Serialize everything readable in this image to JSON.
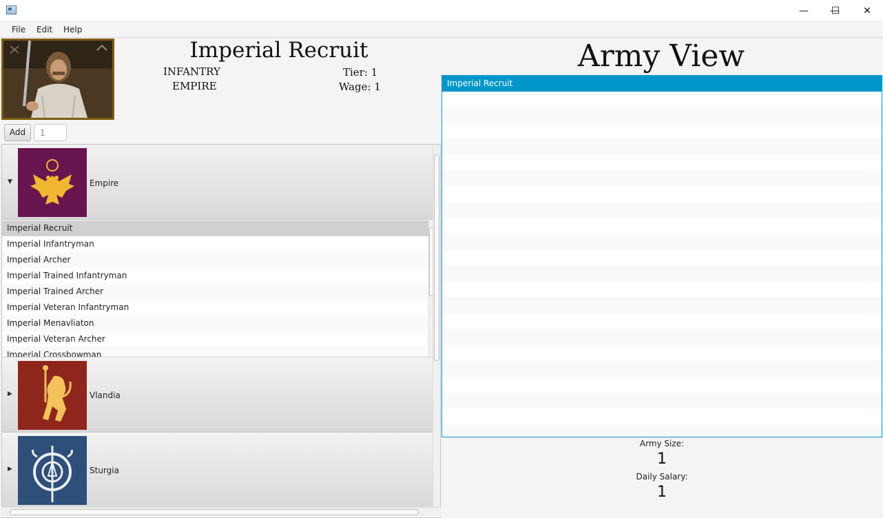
{
  "window": {
    "icons": {
      "app": "app-icon",
      "minimize": "minimize-icon",
      "maximize": "maximize-icon",
      "close": "close-icon"
    },
    "minimize_glyph": "—",
    "maximize_glyph": "☐",
    "close_glyph": "✕"
  },
  "menu": {
    "items": [
      "File",
      "Edit",
      "Help"
    ]
  },
  "unit": {
    "name": "Imperial Recruit",
    "type": "INFANTRY",
    "faction": "EMPIRE",
    "tier": "Tier: 1",
    "wage": "Wage: 1",
    "portrait_icon": "soldier-portrait"
  },
  "add_bar": {
    "button_label": "Add",
    "quantity_value": "1"
  },
  "factions": [
    {
      "name": "Empire",
      "expanded": true,
      "banner_color": "#68154f",
      "emblem_color": "#f2b731",
      "emblem": "double-eagle-icon",
      "units": [
        "Imperial Recruit",
        "Imperial Infantryman",
        "Imperial Archer",
        "Imperial Trained Infantryman",
        "Imperial Trained Archer",
        "Imperial Veteran Infantryman",
        "Imperial Menavliaton",
        "Imperial Veteran Archer",
        "Imperial Crossbowman"
      ]
    },
    {
      "name": "Vlandia",
      "expanded": false,
      "banner_color": "#8f261b",
      "emblem_color": "#f3c25a",
      "emblem": "lion-icon"
    },
    {
      "name": "Sturgia",
      "expanded": false,
      "banner_color": "#2d4f79",
      "emblem_color": "#e9eef4",
      "emblem": "knot-shield-icon"
    }
  ],
  "army": {
    "title": "Army View",
    "units": [
      "Imperial Recruit"
    ],
    "size_label": "Army Size:",
    "size_value": "1",
    "salary_label": "Daily Salary:",
    "salary_value": "1"
  },
  "colors": {
    "selection_blue": "#0096c9",
    "focus_border": "#0097d3",
    "portrait_frame": "#7d5a0d"
  }
}
